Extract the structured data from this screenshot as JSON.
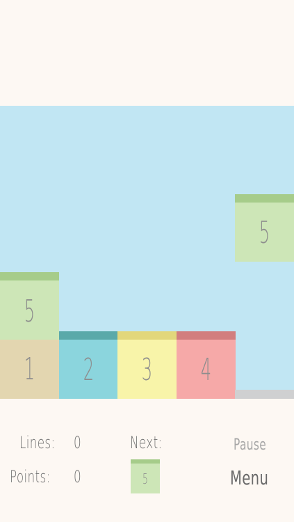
{
  "board": {
    "falling_block": {
      "number": "5",
      "cap_color": "#a6cc8a",
      "body_color": "#cde6b7"
    },
    "stacked_blocks": [
      {
        "number": "5",
        "cap_color": "#a6cc8a",
        "body_color": "#cde6b7"
      },
      {
        "number": "1",
        "cap_color": "",
        "body_color": "#e3d6b0"
      },
      {
        "number": "2",
        "cap_color": "#5aa9a9",
        "body_color": "#8bd5dd"
      },
      {
        "number": "3",
        "cap_color": "#e2d77b",
        "body_color": "#f8f4a9"
      },
      {
        "number": "4",
        "cap_color": "#d27e7e",
        "body_color": "#f6a9a8"
      }
    ],
    "background_color": "#c1e6f3"
  },
  "hud": {
    "lines_label": "Lines:",
    "lines_value": "0",
    "points_label": "Points:",
    "points_value": "0",
    "next_label": "Next:",
    "next_block": {
      "number": "5",
      "color": "#cde6b7"
    },
    "pause_label": "Pause",
    "menu_label": "Menu"
  }
}
